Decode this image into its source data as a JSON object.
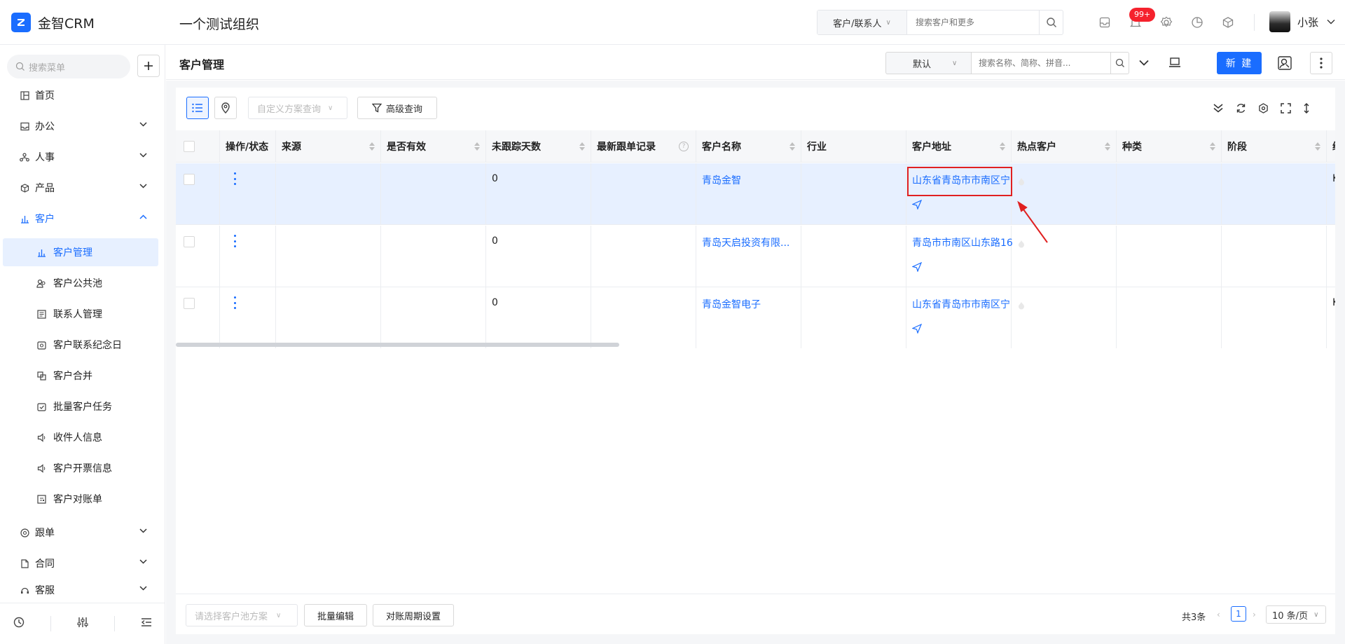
{
  "app": {
    "name": "金智CRM",
    "org": "一个测试组织"
  },
  "global_search": {
    "scope": "客户/联系人",
    "placeholder": "搜索客户和更多"
  },
  "notifications": {
    "badge": "99+"
  },
  "user": {
    "name": "小张"
  },
  "sidebar": {
    "search_placeholder": "搜索菜单",
    "items": [
      {
        "label": "首页",
        "icon": "home-icon"
      },
      {
        "label": "办公",
        "icon": "inbox-icon"
      },
      {
        "label": "人事",
        "icon": "org-icon"
      },
      {
        "label": "产品",
        "icon": "box-icon"
      },
      {
        "label": "客户",
        "icon": "chart-icon"
      },
      {
        "label": "客户管理",
        "icon": "chart-icon"
      },
      {
        "label": "客户公共池",
        "icon": "users-icon"
      },
      {
        "label": "联系人管理",
        "icon": "contact-card-icon"
      },
      {
        "label": "客户联系纪念日",
        "icon": "calendar-icon"
      },
      {
        "label": "客户合并",
        "icon": "merge-icon"
      },
      {
        "label": "批量客户任务",
        "icon": "task-icon"
      },
      {
        "label": "收件人信息",
        "icon": "speaker-icon"
      },
      {
        "label": "客户开票信息",
        "icon": "speaker-icon"
      },
      {
        "label": "客户对账单",
        "icon": "ledger-icon"
      },
      {
        "label": "跟单",
        "icon": "target-icon"
      },
      {
        "label": "合同",
        "icon": "contract-icon"
      },
      {
        "label": "客服",
        "icon": "service-icon"
      }
    ]
  },
  "page": {
    "title": "客户管理",
    "view": "默认",
    "search_placeholder": "搜索名称、简称、拼音...",
    "new_label": "新 建"
  },
  "toolbar": {
    "plan_placeholder": "自定义方案查询",
    "advanced_label": "高级查询"
  },
  "table": {
    "headers": [
      "操作/状态",
      "来源",
      "是否有效",
      "未跟踪天数",
      "最新跟单记录",
      "客户名称",
      "行业",
      "客户地址",
      "热点客户",
      "种类",
      "阶段",
      "编"
    ],
    "rows": [
      {
        "days": "0",
        "name": "青岛金智",
        "address": "山东省青岛市市南区宁",
        "cut": "K"
      },
      {
        "days": "0",
        "name": "青岛天启投资有限...",
        "address": "青岛市市南区山东路16",
        "cut": ""
      },
      {
        "days": "0",
        "name": "青岛金智电子",
        "address": "山东省青岛市市南区宁",
        "cut": "K"
      }
    ]
  },
  "footer": {
    "pool_placeholder": "请选择客户池方案",
    "batch_edit": "批量编辑",
    "cycle_settings": "对账周期设置",
    "total": "共3条",
    "page": "1",
    "page_size": "10 条/页"
  },
  "colors": {
    "primary": "#1a6dff",
    "badge": "#f5222d",
    "highlight": "#e02020"
  }
}
